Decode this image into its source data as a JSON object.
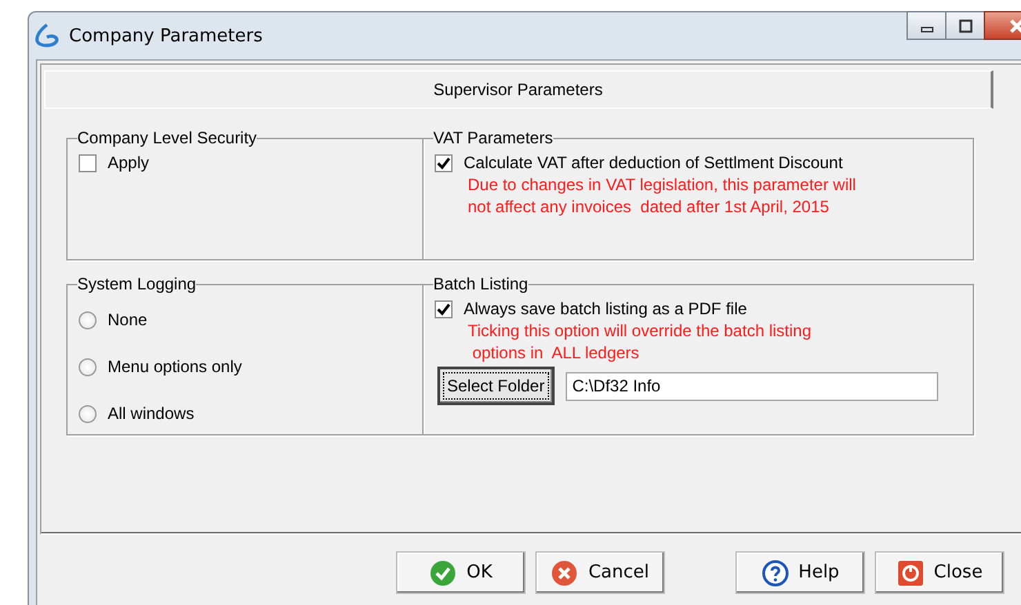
{
  "window": {
    "title": "Company Parameters"
  },
  "tab": {
    "label": "Supervisor Parameters"
  },
  "security": {
    "title": "Company Level Security",
    "option": {
      "label": "Apply",
      "checked": false
    }
  },
  "vat": {
    "title": "VAT Parameters",
    "option": {
      "label": "Calculate VAT after deduction of Settlment Discount",
      "checked": true
    },
    "note": [
      "Due to changes in VAT legislation, this parameter will",
      "not affect any invoices  dated after 1st April, 2015"
    ]
  },
  "logging": {
    "title": "System Logging",
    "options": [
      {
        "label": "None",
        "selected": false
      },
      {
        "label": "Menu options only",
        "selected": false
      },
      {
        "label": "All windows",
        "selected": false
      }
    ]
  },
  "batch": {
    "title": "Batch Listing",
    "option": {
      "label": "Always save batch listing as a PDF file",
      "checked": true
    },
    "note": [
      "Ticking this option will override the batch listing",
      " options in  ALL ledgers"
    ],
    "folder_button": "Select Folder",
    "folder_value": "C:\\Df32 Info"
  },
  "buttons": [
    {
      "kind": "ok",
      "label": "OK"
    },
    {
      "kind": "cancel",
      "label": "Cancel"
    },
    {
      "kind": "help",
      "label": "Help"
    },
    {
      "kind": "close",
      "label": "Close"
    }
  ]
}
